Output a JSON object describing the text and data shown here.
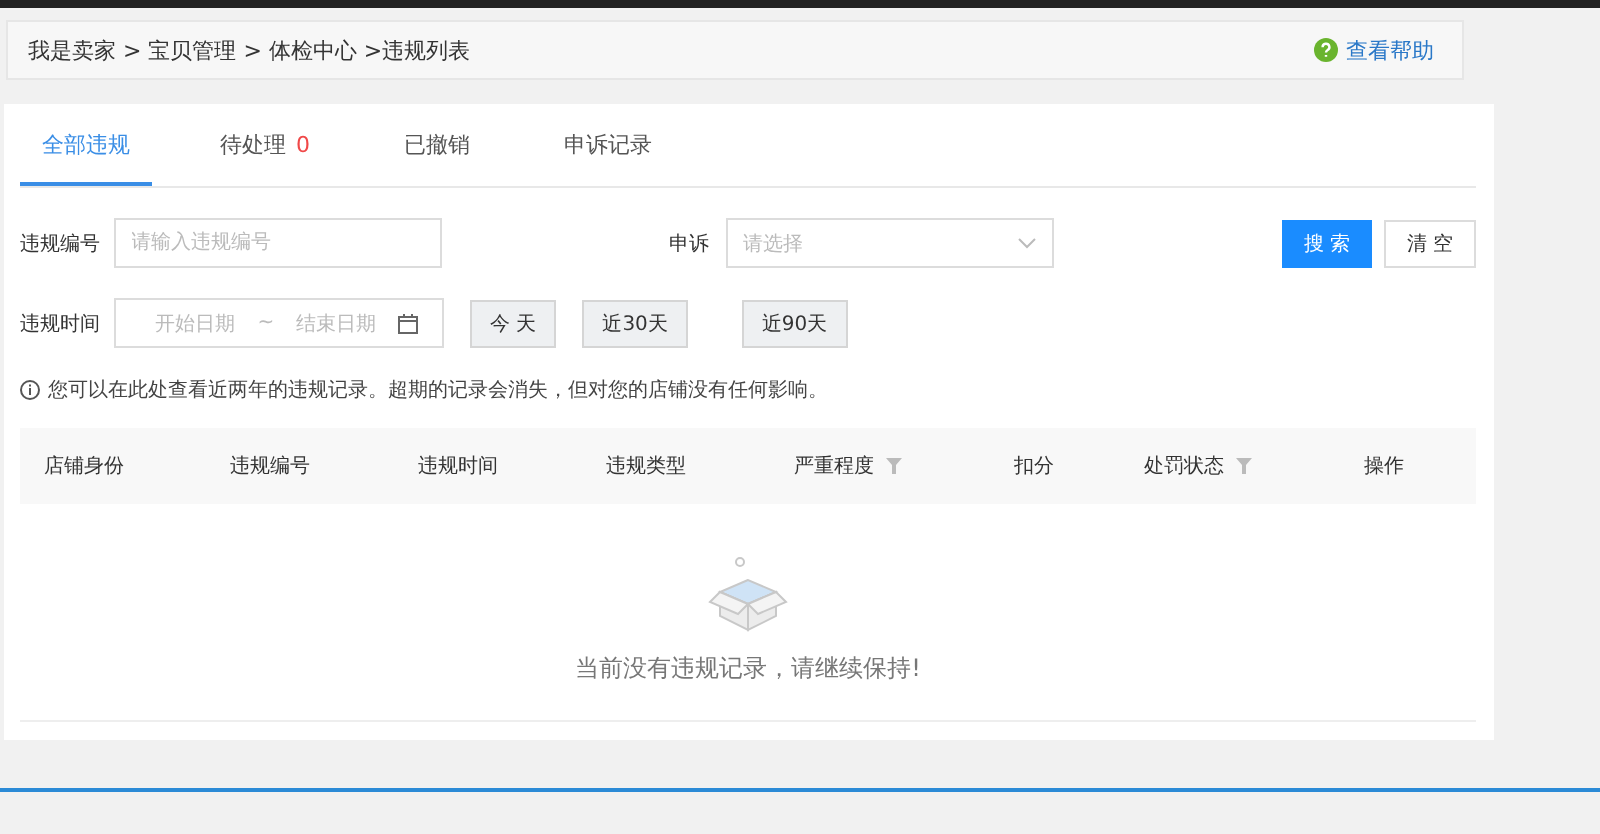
{
  "breadcrumb": {
    "path": "我是卖家 > 宝贝管理 > 体检中心 >违规列表",
    "help": "查看帮助"
  },
  "tabs": [
    {
      "label": "全部违规",
      "selected": true
    },
    {
      "label": "待处理",
      "count": "0",
      "selected": false
    },
    {
      "label": "已撤销",
      "selected": false
    },
    {
      "label": "申诉记录",
      "selected": false
    }
  ],
  "filters": {
    "id_label": "违规编号",
    "id_placeholder": "请输入违规编号",
    "appeal_label": "申诉",
    "appeal_placeholder": "请选择",
    "time_label": "违规时间",
    "start_placeholder": "开始日期",
    "range_sep": "~",
    "end_placeholder": "结束日期",
    "quick_ranges": [
      {
        "label": "今 天"
      },
      {
        "label": "近30天"
      },
      {
        "label": "近90天"
      }
    ],
    "search": "搜 索",
    "clear": "清 空"
  },
  "notice": "您可以在此处查看近两年的违规记录。超期的记录会消失，但对您的店铺没有任何影响。",
  "table": {
    "columns": [
      {
        "label": "店铺身份",
        "filter": false
      },
      {
        "label": "违规编号",
        "filter": false
      },
      {
        "label": "违规时间",
        "filter": false
      },
      {
        "label": "违规类型",
        "filter": false
      },
      {
        "label": "严重程度",
        "filter": true
      },
      {
        "label": "扣分",
        "filter": false
      },
      {
        "label": "处罚状态",
        "filter": true
      },
      {
        "label": "操作",
        "filter": false
      }
    ],
    "empty_text": "当前没有违规记录，请继续保持!"
  }
}
